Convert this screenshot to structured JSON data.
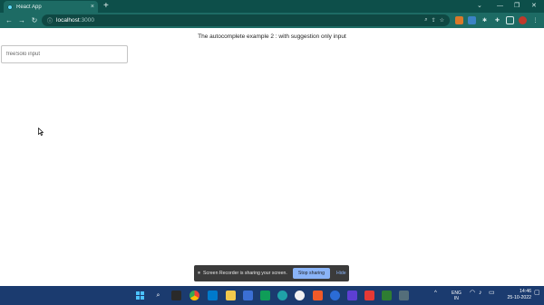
{
  "browser": {
    "tab_title": "React App",
    "tab_close": "×",
    "new_tab": "+",
    "url_host": "localhost",
    "url_port": ":3000",
    "controls": {
      "minimize": "—",
      "restore": "❐",
      "close": "✕",
      "chevron": "⌄"
    }
  },
  "page": {
    "heading": "The autocomplete example 2 : with suggestion only input",
    "input_placeholder": "freeSolo input"
  },
  "share_bar": {
    "message": "Screen Recorder is sharing your screen.",
    "stop_label": "Stop sharing",
    "hide_label": "Hide"
  },
  "taskbar": {
    "lang_top": "ENG",
    "lang_bottom": "IN",
    "time": "14:46",
    "date": "25-10-2022"
  }
}
